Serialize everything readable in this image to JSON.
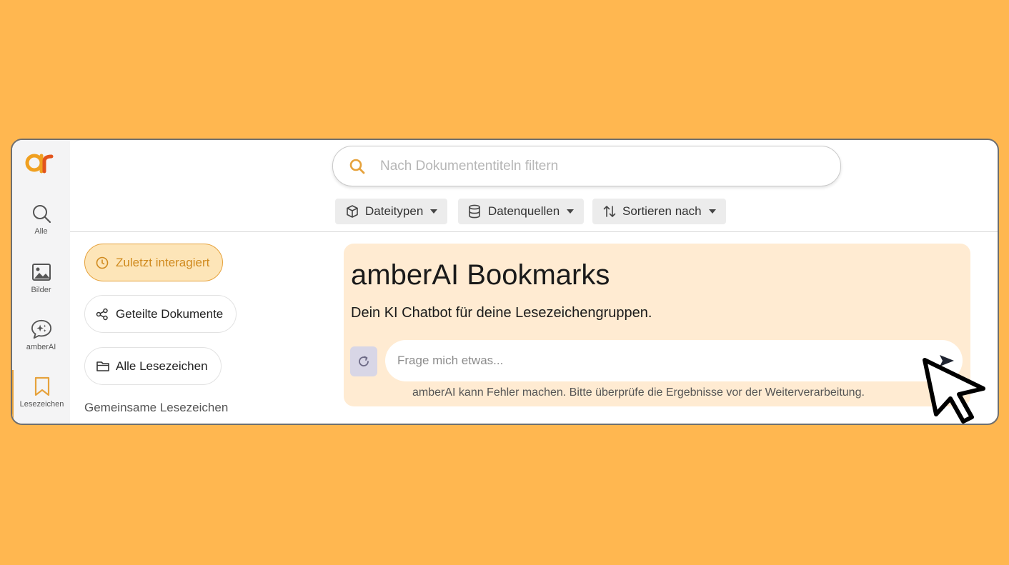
{
  "rail": {
    "items": [
      {
        "label": "Alle",
        "icon": "search-icon"
      },
      {
        "label": "Bilder",
        "icon": "image-icon"
      },
      {
        "label": "amberAI",
        "icon": "chat-sparkle-icon"
      },
      {
        "label": "Lesezeichen",
        "icon": "bookmark-icon"
      }
    ],
    "active": "Lesezeichen"
  },
  "search": {
    "placeholder": "Nach Dokumententiteln filtern"
  },
  "filters": [
    {
      "label": "Dateitypen",
      "icon": "cube-icon"
    },
    {
      "label": "Datenquellen",
      "icon": "database-icon"
    },
    {
      "label": "Sortieren nach",
      "icon": "sort-arrows-icon"
    }
  ],
  "sidebar": {
    "recent_label": "Zuletzt interagiert",
    "shared_label": "Geteilte Dokumente",
    "all_label": "Alle Lesezeichen",
    "section_label": "Gemeinsame Lesezeichen"
  },
  "chat": {
    "title": "amberAI Bookmarks",
    "subtitle": "Dein KI Chatbot für deine Lesezeichengruppen.",
    "input_placeholder": "Frage mich etwas...",
    "disclaimer": "amberAI kann Fehler machen. Bitte überprüfe die Ergebnisse vor der Weiterverarbeitung."
  },
  "colors": {
    "background": "#FFB750",
    "accent": "#E6A23C",
    "panel": "#FFEBD2"
  }
}
